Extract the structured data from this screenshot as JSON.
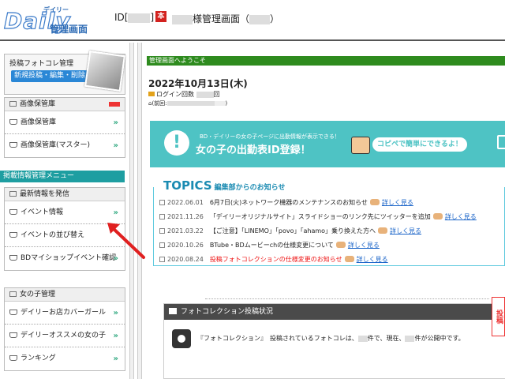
{
  "header": {
    "logo_small": "デイリー",
    "logo_word": "Daily",
    "logo_sub": "管理画面",
    "id_prefix": "ID[",
    "id_suffix": "]",
    "badge": "本",
    "user_suffix": "様管理画面（",
    "user_close": "）"
  },
  "sidebar": {
    "top_title": "投稿フォトコレ管理",
    "top_button": "新規投稿・編集・削除",
    "gallery_head": "画像保管庫",
    "gallery_items": [
      "画像保管庫",
      "画像保管庫(マスター)"
    ],
    "section_label": "掲載情報管理メニュー",
    "news_head": "最新情報を発信",
    "news_items": [
      "イベント情報",
      "イベントの並び替え",
      "BDマイショップイベント確認"
    ],
    "girls_head": "女の子管理",
    "girls_items": [
      "デイリーお店カバーガール",
      "デイリーオススメの女の子",
      "ランキング"
    ],
    "chevron": "»"
  },
  "main": {
    "welcome": "管理画面へようこそ",
    "date": "2022年10月13日(木)",
    "login_label": "ログイン回数",
    "login_suffix": "回",
    "prev_label": "(前回:",
    "prev_close": ")",
    "banner": {
      "sub": "BD・デイリーの女の子ページに出勤情報が表示できる！",
      "title": "女の子の出勤表ID登録！",
      "copy": "コピペで簡単にできるよ！"
    },
    "topics": {
      "title": "TOPICS",
      "subtitle": "編集部からのお知らせ",
      "link_label": "詳しく見る",
      "items": [
        {
          "date": "2022.06.01",
          "text": "6月7日(火)ネットワーク機器のメンテナンスのお知らせ",
          "red": false
        },
        {
          "date": "2021.11.26",
          "text": "「デイリーオリジナルサイト」スライドショーのリンク先にツイッターを追加",
          "red": false
        },
        {
          "date": "2021.03.22",
          "text": "【ご注意】「LINEMO」「povo」「ahamo」乗り換えた方へ",
          "red": false
        },
        {
          "date": "2020.10.26",
          "text": "BTube・BDムービーchの仕様変更について",
          "red": false
        },
        {
          "date": "2020.08.24",
          "text": "投稿フォトコレクションの仕様変更のお知らせ",
          "red": true
        }
      ]
    },
    "photo_collection": {
      "head": "フォトコレクション投稿状況",
      "body_1": "『フォトコレクション』　投稿されているフォトコレは、",
      "body_2": "件で、現在、",
      "body_3": "件が公開中です。",
      "side_badge": "投稿"
    }
  },
  "colors": {
    "green_bar": "#2e8b1e",
    "teal": "#4ec3c4",
    "section_teal": "#1e9ea1",
    "link_blue": "#1a64c8",
    "red": "#e11111"
  }
}
